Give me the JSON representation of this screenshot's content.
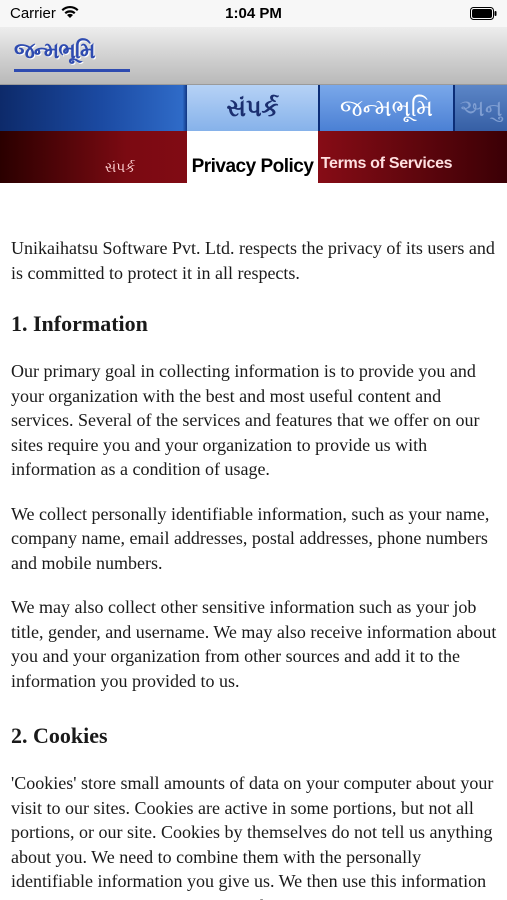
{
  "status_bar": {
    "carrier": "Carrier",
    "time": "1:04 PM"
  },
  "header": {
    "logo_text": "જન્મભૂમિ",
    "nav_tabs": [
      {
        "label": "સંપર્ક",
        "active": true
      },
      {
        "label": "જન્મભૂમિ",
        "active": false
      },
      {
        "label": "અનુ",
        "active": false
      }
    ],
    "sub_tabs": [
      {
        "label": "સંપર્ક",
        "active": false
      },
      {
        "label": "Privacy Policy",
        "active": true
      },
      {
        "label": "Terms of Services",
        "active": false
      }
    ]
  },
  "content": {
    "intro": "Unikaihatsu Software Pvt. Ltd. respects the privacy of its users and is committed to protect it in all respects.",
    "section1_title": "1. Information",
    "section1_p1": "Our primary goal in collecting information is to provide you and your organization with the best and most useful content and services. Several of the services and features that we offer on our sites require you and your organization to provide us with information as a condition of usage.",
    "section1_p2": "We collect personally identifiable information, such as your name, company name, email addresses, postal addresses, phone numbers and mobile numbers.",
    "section1_p3": "We may also collect other sensitive information such as your job title, gender, and username. We may also receive information about you and your organization from other sources and add it to the information you provided to us.",
    "section2_title": "2. Cookies",
    "section2_p1": "'Cookies' store small amounts of data on your computer about your visit to our sites. Cookies are active in some portions, but not all portions, or our site. Cookies by themselves do not tell us anything about you. We need to combine them with the personally identifiable information you give us. We then use this information to improve our services. You can choose to"
  },
  "colors": {
    "nav_blue": "#0c2e78",
    "active_tab": "#86b2ea",
    "nav_red": "#8c0d17",
    "logo_blue": "#2e4bb0"
  }
}
